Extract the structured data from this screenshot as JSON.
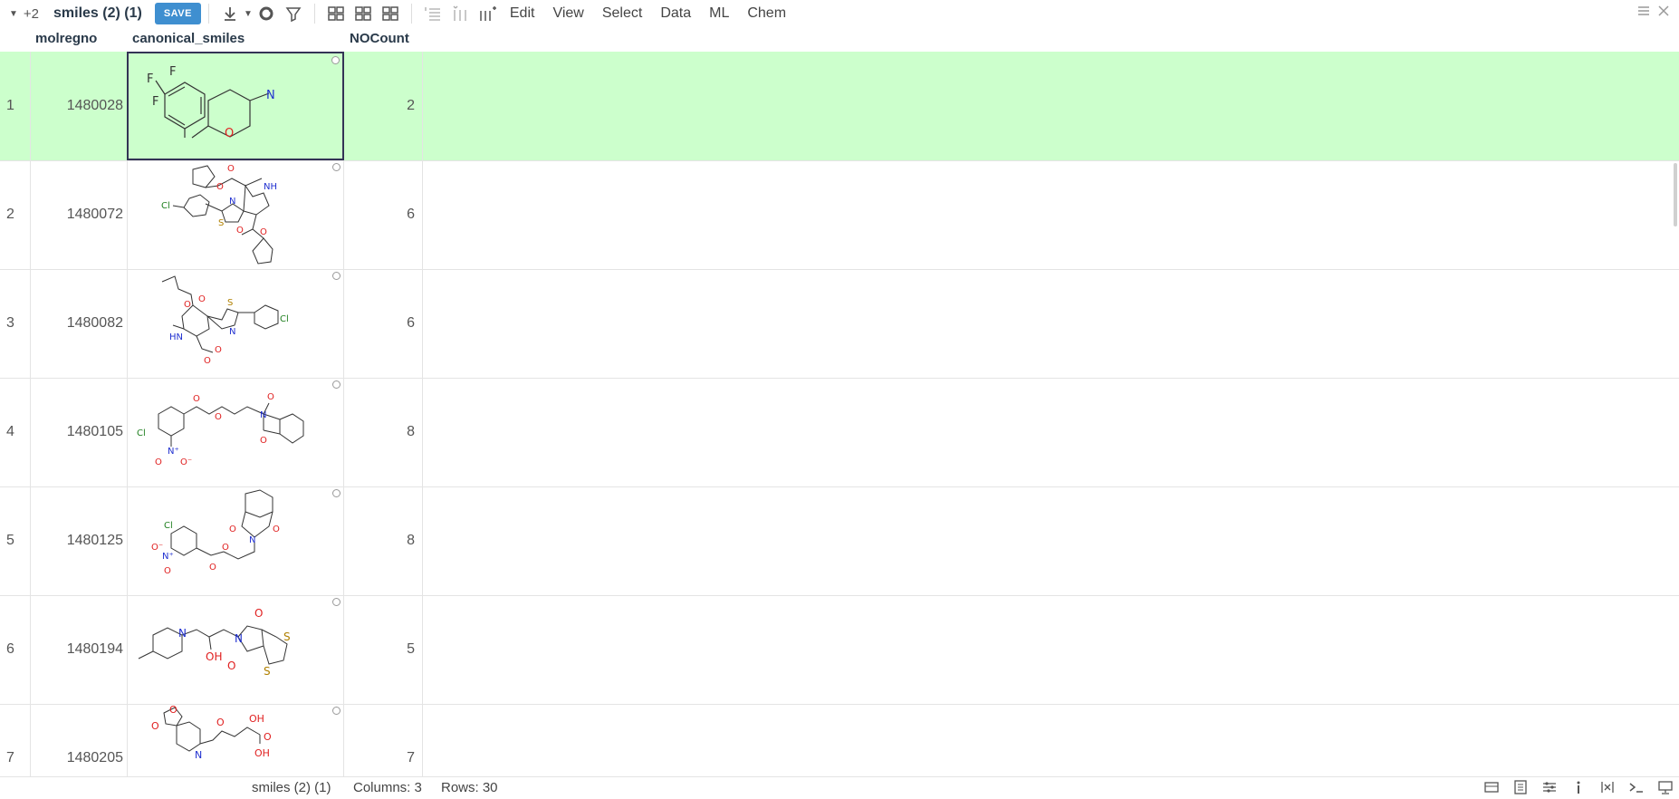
{
  "toolbar": {
    "expand": "+2",
    "view_title": "smiles (2) (1)",
    "save_label": "SAVE",
    "menus": [
      "Edit",
      "View",
      "Select",
      "Data",
      "ML",
      "Chem"
    ]
  },
  "grid": {
    "columns": [
      "molregno",
      "canonical_smiles",
      "NOCount"
    ],
    "rows": [
      {
        "num": "1",
        "molregno": "1480028",
        "nocount": "2"
      },
      {
        "num": "2",
        "molregno": "1480072",
        "nocount": "6"
      },
      {
        "num": "3",
        "molregno": "1480082",
        "nocount": "6"
      },
      {
        "num": "4",
        "molregno": "1480105",
        "nocount": "8"
      },
      {
        "num": "5",
        "molregno": "1480125",
        "nocount": "8"
      },
      {
        "num": "6",
        "molregno": "1480194",
        "nocount": "5"
      },
      {
        "num": "7",
        "molregno": "1480205",
        "nocount": "7"
      }
    ]
  },
  "status": {
    "table": "smiles (2) (1)",
    "columns": "Columns: 3",
    "rows": "Rows: 30"
  },
  "colors": {
    "accent": "#3f8fd0",
    "selected_row": "#ccffcc",
    "oxygen": "#e02020",
    "nitrogen": "#2030d0",
    "chlorine": "#208020"
  }
}
